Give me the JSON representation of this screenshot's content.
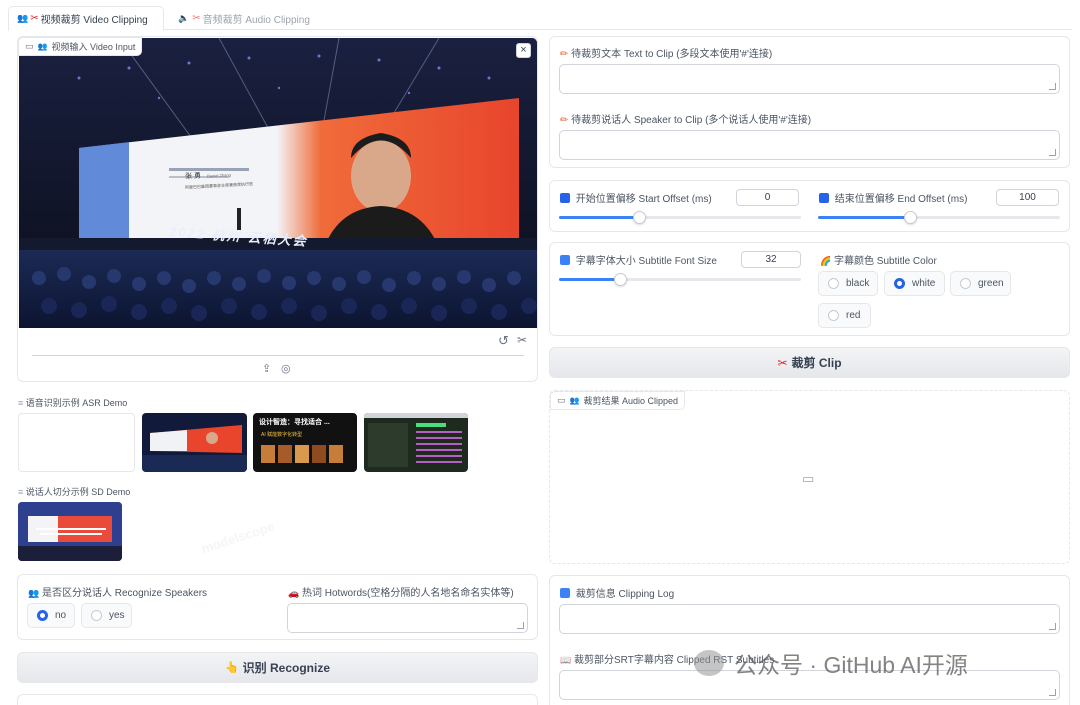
{
  "tabs": [
    {
      "icon": "👨‍👩‍👧",
      "label": "视频裁剪 Video Clipping",
      "active": true
    },
    {
      "icon": "🔈",
      "label": "音频裁剪 Audio Clipping",
      "active": false
    }
  ],
  "video_input": {
    "label": "视频输入 Video Input",
    "close": "×"
  },
  "slide": {
    "name": "张 勇",
    "sub": "Daniel Zhang",
    "desc": "阿里巴巴集团董事会主席兼首席执行官",
    "banner": "2022 杭州·云栖大会"
  },
  "asr_demo": {
    "label": "语音识别示例 ASR Demo",
    "thumb3_title": "设计智造：寻找适合 ...",
    "thumb3_sub": "AI 赋能数字化转型"
  },
  "sd_demo": {
    "label": "说话人切分示例 SD Demo"
  },
  "recognize_speakers": {
    "label": "是否区分说话人 Recognize Speakers",
    "options": [
      "no",
      "yes"
    ],
    "selected": "no"
  },
  "hotwords": {
    "label": "热词 Hotwords(空格分隔的人名地名命名实体等)"
  },
  "recognize_button": {
    "label": "识别 Recognize"
  },
  "text_to_clip": {
    "label": "待裁剪文本 Text to Clip (多段文本使用'#'连接)"
  },
  "speaker_to_clip": {
    "label": "待裁剪说话人 Speaker to Clip (多个说话人使用'#'连接)"
  },
  "start_offset": {
    "label": "开始位置偏移 Start Offset (ms)",
    "value": "0",
    "fraction": 0.33
  },
  "end_offset": {
    "label": "结束位置偏移 End Offset (ms)",
    "value": "100",
    "fraction": 0.38
  },
  "font_size": {
    "label": "字幕字体大小 Subtitle Font Size",
    "value": "32",
    "fraction": 0.25
  },
  "subtitle_color": {
    "label": "字幕颜色 Subtitle Color",
    "options": [
      "black",
      "white",
      "green",
      "red"
    ],
    "selected": "white"
  },
  "clip_button": {
    "label": "裁剪 Clip"
  },
  "audio_clipped": {
    "label": "裁剪结果 Audio Clipped"
  },
  "clipping_log": {
    "label": "裁剪信息 Clipping Log"
  },
  "srt_subtitles": {
    "label": "裁剪部分SRT字幕内容 Clipped RST Subtitles"
  },
  "watermark": {
    "text": "公众号 · GitHub AI开源"
  },
  "bg_watermark": "modelscope",
  "colors": {
    "accent": "#2563eb",
    "slide_red": "#e8452c"
  }
}
